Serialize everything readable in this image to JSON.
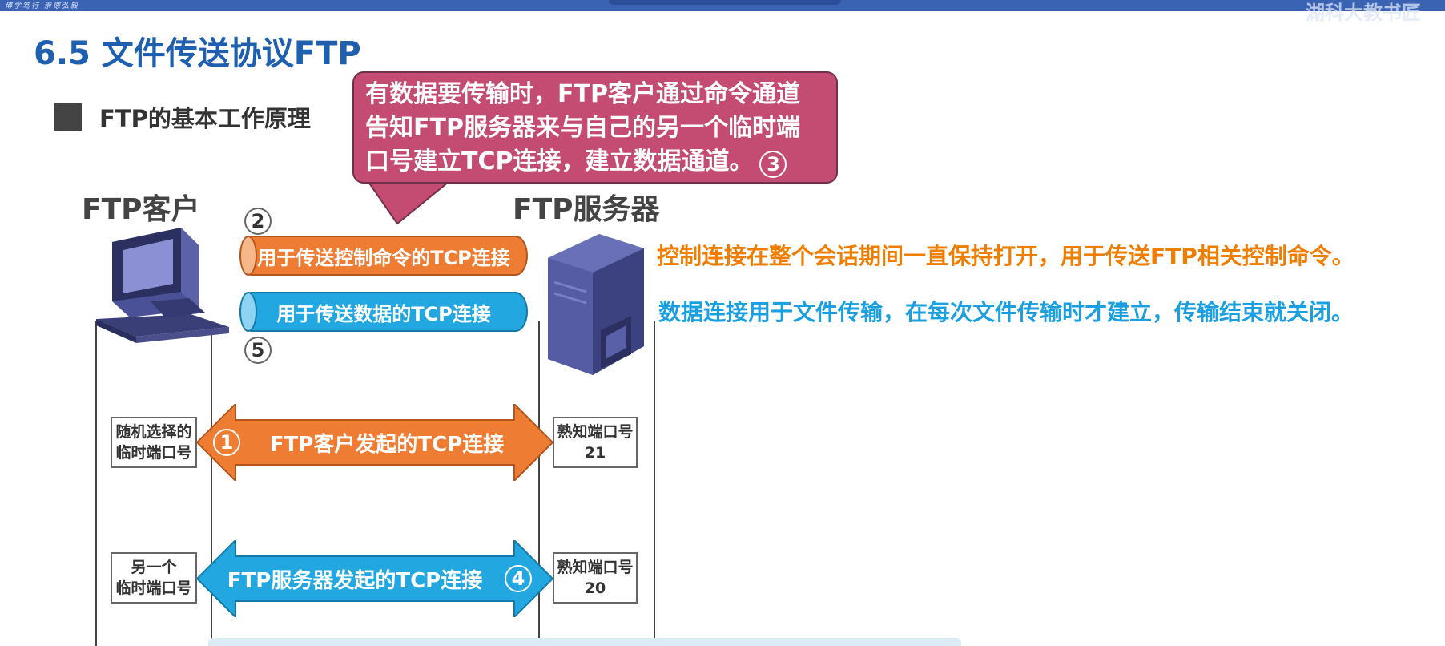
{
  "header": {
    "motto": "博学笃行 崇德弘毅",
    "brand": "湖科大教书匠"
  },
  "slide": {
    "title": "6.5 文件传送协议FTP",
    "section": "FTP的基本工作原理"
  },
  "callout": {
    "lines": [
      "有数据要传输时，FTP客户通过命令通道",
      "告知FTP服务器来与自己的另一个临时端",
      "口号建立TCP连接，建立数据通道。"
    ],
    "step": "3",
    "color": "#c44c72"
  },
  "client": {
    "label": "FTP客户",
    "icon": "computer-icon"
  },
  "server": {
    "label": "FTP服务器",
    "icon": "server-icon"
  },
  "connections": {
    "control": {
      "step": "2",
      "label": "用于传送控制命令的TCP连接",
      "color": "#ee7d33"
    },
    "data": {
      "step": "5",
      "label": "用于传送数据的TCP连接",
      "color": "#22a7e0"
    }
  },
  "ports": {
    "client_random": [
      "随机选择的",
      "临时端口号"
    ],
    "client_other": [
      "另一个",
      "临时端口号"
    ],
    "server_21": [
      "熟知端口号",
      "21"
    ],
    "server_20": [
      "熟知端口号",
      "20"
    ]
  },
  "arrows": {
    "client_initiated": {
      "step": "1",
      "label": "FTP客户发起的TCP连接",
      "color": "#ee7d33"
    },
    "server_initiated": {
      "step": "4",
      "label": "FTP服务器发起的TCP连接",
      "color": "#22a7e0"
    }
  },
  "notes": {
    "control": {
      "text": "控制连接在整个会话期间一直保持打开，用于传送FTP相关控制命令。",
      "color": "#ee7d00"
    },
    "data": {
      "text": "数据连接用于文件传输，在每次文件传输时才建立，传输结束就关闭。",
      "color": "#1a9fe0"
    }
  }
}
